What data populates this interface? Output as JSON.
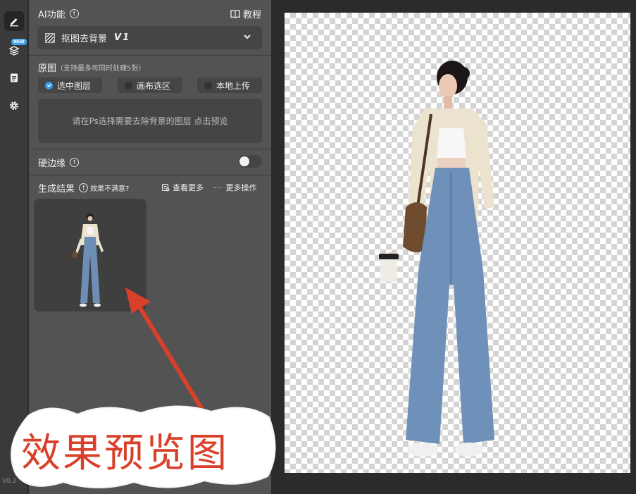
{
  "rail": {
    "items": [
      {
        "name": "edit",
        "icon": "pencil-icon"
      },
      {
        "name": "layers",
        "icon": "layers-icon",
        "badge": "NEW"
      },
      {
        "name": "notes",
        "icon": "clipboard-icon"
      },
      {
        "name": "settings",
        "icon": "gear-icon"
      }
    ],
    "version": "V0.2"
  },
  "ai": {
    "title": "AI功能",
    "tutorial": "教程",
    "feature": "抠图去背景",
    "feature_version": "V1"
  },
  "source": {
    "title": "原图",
    "note": "（支持最多可同时处理5张）",
    "options": [
      "选中图层",
      "画布选区",
      "本地上传"
    ],
    "selected": "选中图层",
    "placeholder": "请在Ps选择需要去除背景的图层 点击预览"
  },
  "hard_edge": {
    "label": "硬边缘",
    "enabled": false
  },
  "results": {
    "title": "生成结果",
    "unsatisfied": "效果不满意?",
    "view_more": "查看更多",
    "more_actions": "更多操作"
  },
  "annotation": {
    "text": "效果预览图",
    "color": "#d9402a"
  },
  "colors": {
    "panel": "#535353",
    "accent": "#2f9bf0"
  }
}
